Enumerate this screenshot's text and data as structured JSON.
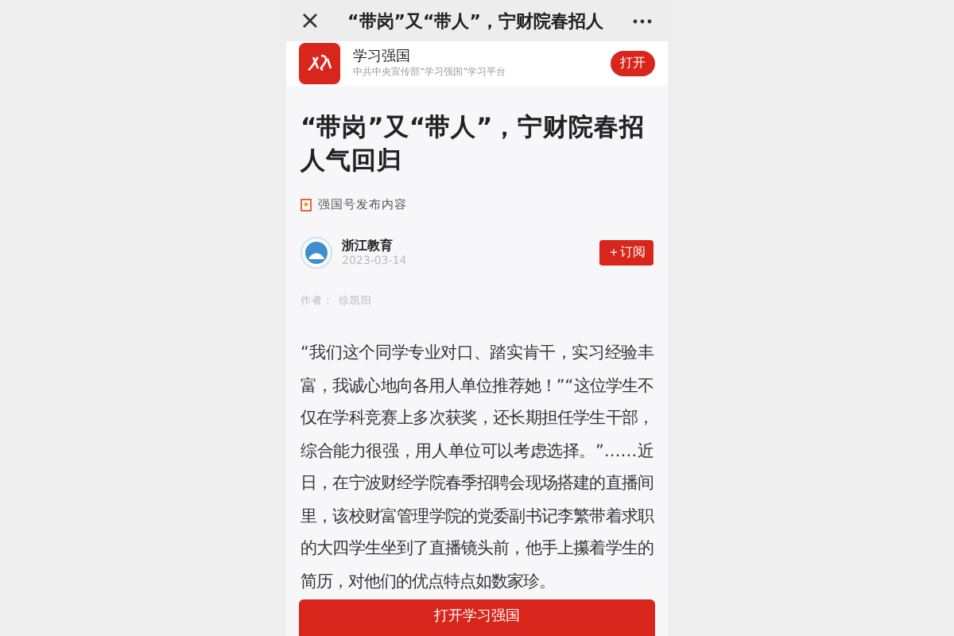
{
  "top_bar": {
    "title": "“带岗”又“带人”，宁财院春招人"
  },
  "app_banner": {
    "name": "学习强国",
    "subtitle": "中共中央宣传部“学习强国”学习平台",
    "button": "打开"
  },
  "article": {
    "title": "“带岗”又“带人”，宁财院春招人气回归",
    "source_tag": "强国号发布内容",
    "publisher": {
      "name": "浙江教育",
      "date": "2023-03-14",
      "subscribe": "＋订阅"
    },
    "author_label": "作者：",
    "author": "徐凯阳",
    "body": "“我们这个同学专业对口、踏实肯干，实习经验丰富，我诚心地向各用人单位推荐她！”“这位学生不仅在学科竞赛上多次获奖，还长期担任学生干部，综合能力很强，用人单位可以考虑选择。”……近日，在宁波财经学院春季招聘会现场搭建的直播间里，该校财富管理学院的党委副书记李繁带着求职的大四学生坐到了直播镜头前，他手上攥着学生的简历，对他们的优点特点如数家珍。"
  },
  "bottom_button": "打开学习强国"
}
